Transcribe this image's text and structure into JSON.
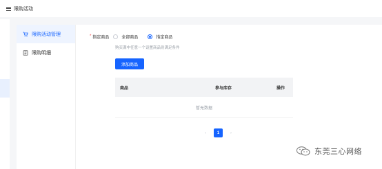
{
  "header": {
    "title": "限购活动"
  },
  "sidebar": {
    "items": [
      {
        "label": "限购活动管理",
        "icon": "cart-icon",
        "active": true
      },
      {
        "label": "限购明细",
        "icon": "list-icon",
        "active": false
      }
    ]
  },
  "form": {
    "required_mark": "*",
    "field_label": "指定商品",
    "options": [
      {
        "label": "全部商品",
        "checked": false
      },
      {
        "label": "指定商品",
        "checked": true
      }
    ],
    "hint": "购买满中任意一个设置商品则满足条件",
    "add_button_label": "添加商品"
  },
  "table": {
    "columns": [
      "商品",
      "参与库存",
      "操作"
    ],
    "rows": [],
    "empty_text": "暂无数据"
  },
  "pagination": {
    "prev": "‹",
    "current_page": "1",
    "next": "›"
  },
  "watermark": {
    "text": "东莞三心网络"
  },
  "colors": {
    "accent": "#1664ff",
    "required": "#f53f3f",
    "muted": "#9aa0a8"
  }
}
